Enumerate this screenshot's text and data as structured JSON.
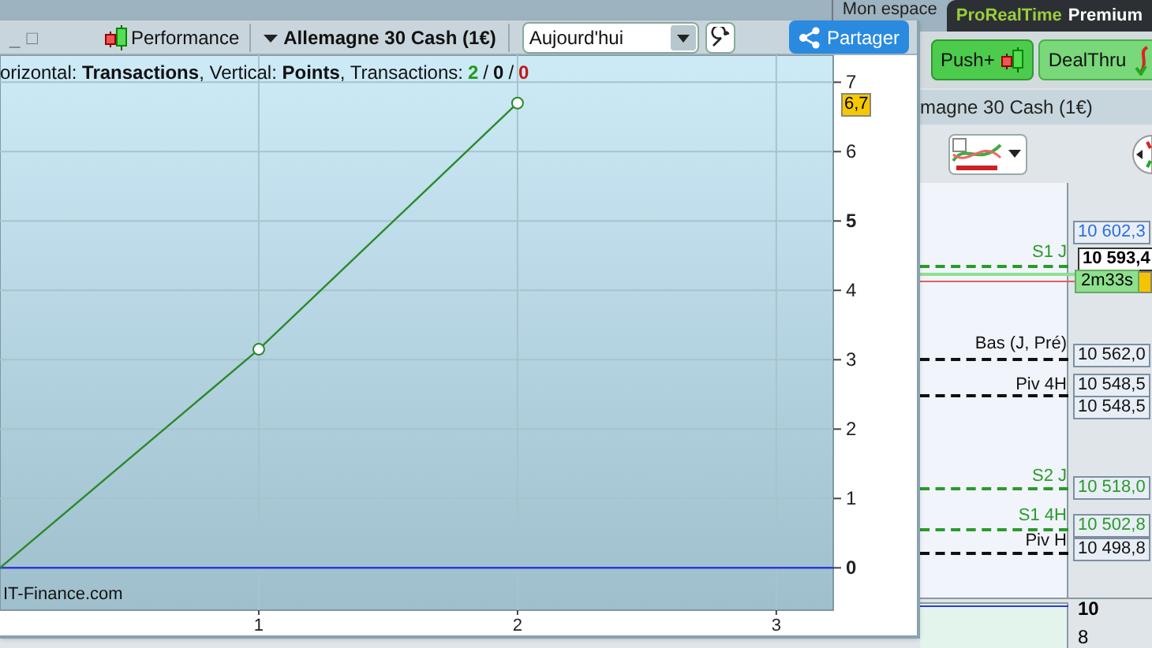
{
  "background_app": {
    "tabs": [
      {
        "label": "Mon espace",
        "selected": false
      },
      {
        "label": "ProRealTime Premium",
        "selected": true
      }
    ],
    "buttons": [
      {
        "label": "Push+",
        "kind": "candles"
      },
      {
        "label": "DealThru",
        "kind": "arrow"
      }
    ],
    "chart_title": "magne 30 Cash (1€)",
    "price_lines": [
      {
        "label": "S1 J",
        "color": "#2a9a2a"
      },
      {
        "label": "Bas (J, Pré)",
        "color": "#111111"
      },
      {
        "label": "Piv 4H",
        "color": "#111111"
      },
      {
        "label": "S2 J",
        "color": "#2a9a2a"
      },
      {
        "label": "S1 4H",
        "color": "#2a9a2a"
      },
      {
        "label": "Piv H",
        "color": "#111111"
      }
    ],
    "price_labels": [
      {
        "value": "10 602,3",
        "color": "#2b6fe0"
      },
      {
        "value": "10 593,4",
        "color": "#000000"
      },
      {
        "value": "2m33s",
        "kind": "timer"
      },
      {
        "value": "10 562,0",
        "color": "#111111"
      },
      {
        "value": "10 548,5",
        "color": "#111111"
      },
      {
        "value": "10 548,5",
        "color": "#111111"
      },
      {
        "value": "10 518,0",
        "color": "#2a9a2a"
      },
      {
        "value": "10 502,8",
        "color": "#2a9a2a"
      },
      {
        "value": "10 498,8",
        "color": "#111111"
      }
    ],
    "lower_axis": [
      "10",
      "8"
    ]
  },
  "window": {
    "controls": [
      "_",
      "□"
    ],
    "performance_button": "Performance",
    "instrument": "Allemagne 30 Cash (1€)",
    "period": {
      "value": "Aujourd'hui"
    },
    "share_button": "Partager",
    "caption": "orizontal: **Transactions**, Vertical: **Points**, Transactions: ",
    "count_separator": "/",
    "counts": [
      {
        "value": "2",
        "color": "#1f9a1f"
      },
      {
        "value": "0",
        "color": "#111111"
      },
      {
        "value": "0",
        "color": "#c01818"
      }
    ],
    "source": "IT-Finance.com",
    "chart_data": {
      "type": "line",
      "x": [
        0,
        1,
        2
      ],
      "series": [
        {
          "color": "#2a8a2a",
          "marker": "o",
          "values": [
            0,
            3.15,
            6.7
          ]
        }
      ],
      "xticks": [
        1,
        2,
        3
      ],
      "yticks": [
        0,
        1,
        2,
        3,
        4,
        5,
        6,
        7
      ],
      "xlim": [
        0,
        3.22
      ],
      "ylim": [
        -0.61,
        7.39
      ],
      "grid": true,
      "ref_lines": [
        {
          "axis": "y",
          "value": 0,
          "color": "#2a3ad8"
        }
      ],
      "annotations": [
        "6,7"
      ]
    }
  }
}
